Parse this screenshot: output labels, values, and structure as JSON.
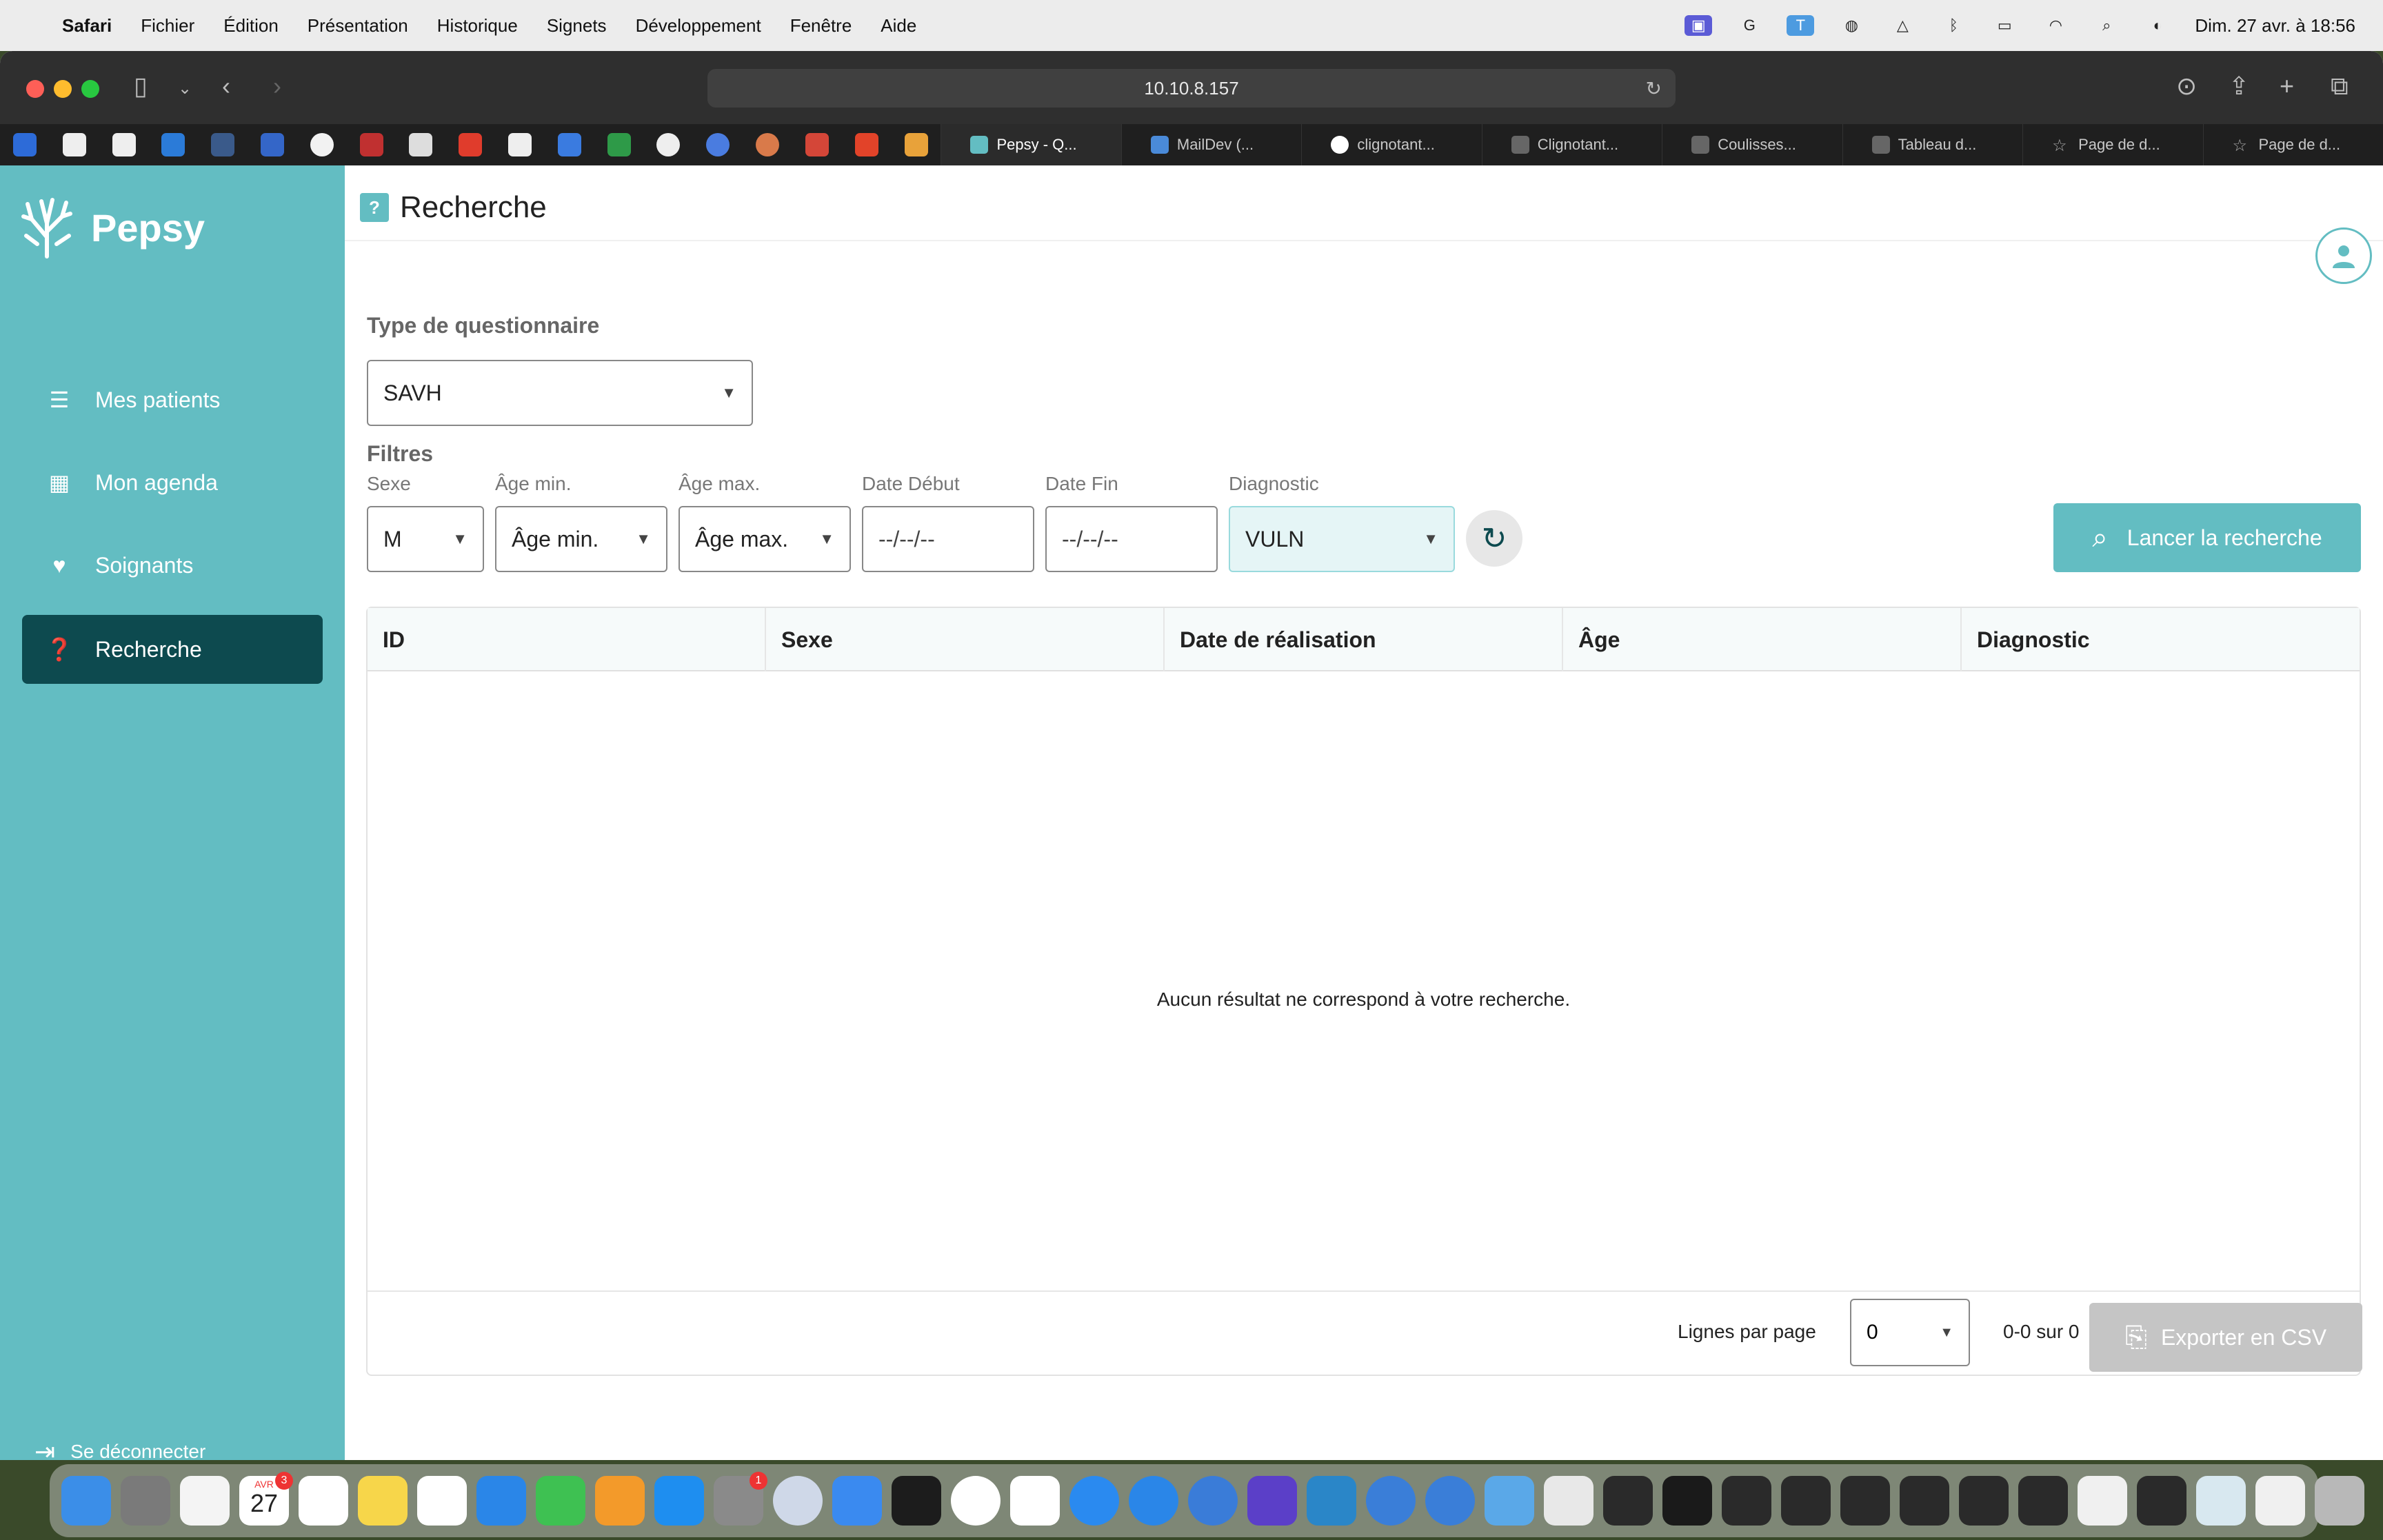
{
  "menubar": {
    "app_name": "Safari",
    "menus": [
      "Fichier",
      "Édition",
      "Présentation",
      "Historique",
      "Signets",
      "Développement",
      "Fenêtre",
      "Aide"
    ],
    "clock": "Dim. 27 avr. à 18:56"
  },
  "browser": {
    "url": "10.10.8.157",
    "tabs": [
      "Pepsy - Q...",
      "MailDev (...",
      "clignotant...",
      "Clignotant...",
      "Coulisses...",
      "Tableau d...",
      "Page de d...",
      "Page de d..."
    ]
  },
  "sidebar": {
    "brand": "Pepsy",
    "items": [
      {
        "label": "Mes patients"
      },
      {
        "label": "Mon agenda"
      },
      {
        "label": "Soignants"
      },
      {
        "label": "Recherche"
      }
    ],
    "logout": "Se déconnecter"
  },
  "page": {
    "title": "Recherche",
    "questionnaire_label": "Type de questionnaire",
    "questionnaire_value": "SAVH",
    "filters_label": "Filtres",
    "filters": {
      "sexe_label": "Sexe",
      "sexe_value": "M",
      "age_min_label": "Âge min.",
      "age_min_value": "Âge min.",
      "age_max_label": "Âge max.",
      "age_max_value": "Âge max.",
      "date_debut_label": "Date Début",
      "date_debut_value": "--/--/--",
      "date_fin_label": "Date Fin",
      "date_fin_value": "--/--/--",
      "diagnostic_label": "Diagnostic",
      "diagnostic_value": "VULN"
    },
    "search_button": "Lancer la recherche",
    "table": {
      "columns": [
        "ID",
        "Sexe",
        "Date de réalisation",
        "Âge",
        "Diagnostic"
      ],
      "empty_message": "Aucun résultat ne correspond à votre recherche.",
      "rows_per_page_label": "Lignes par page",
      "rows_per_page_value": "0",
      "range": "0-0 sur 0"
    },
    "export_button": "Exporter en CSV"
  },
  "colors": {
    "accent": "#63bdc2",
    "nav_active": "#0d4a4f",
    "disabled": "#c5c5c5"
  },
  "icons": {
    "nav": [
      "patients-list-icon",
      "calendar-icon",
      "caregiver-icon",
      "search-doc-icon"
    ],
    "reset": "refresh-icon",
    "search": "magnifier-icon",
    "export": "file-export-icon"
  },
  "dock": {
    "calendar_badge": "3",
    "calendar_day": "27",
    "calendar_month": "AVR",
    "settings_badge": "1"
  }
}
